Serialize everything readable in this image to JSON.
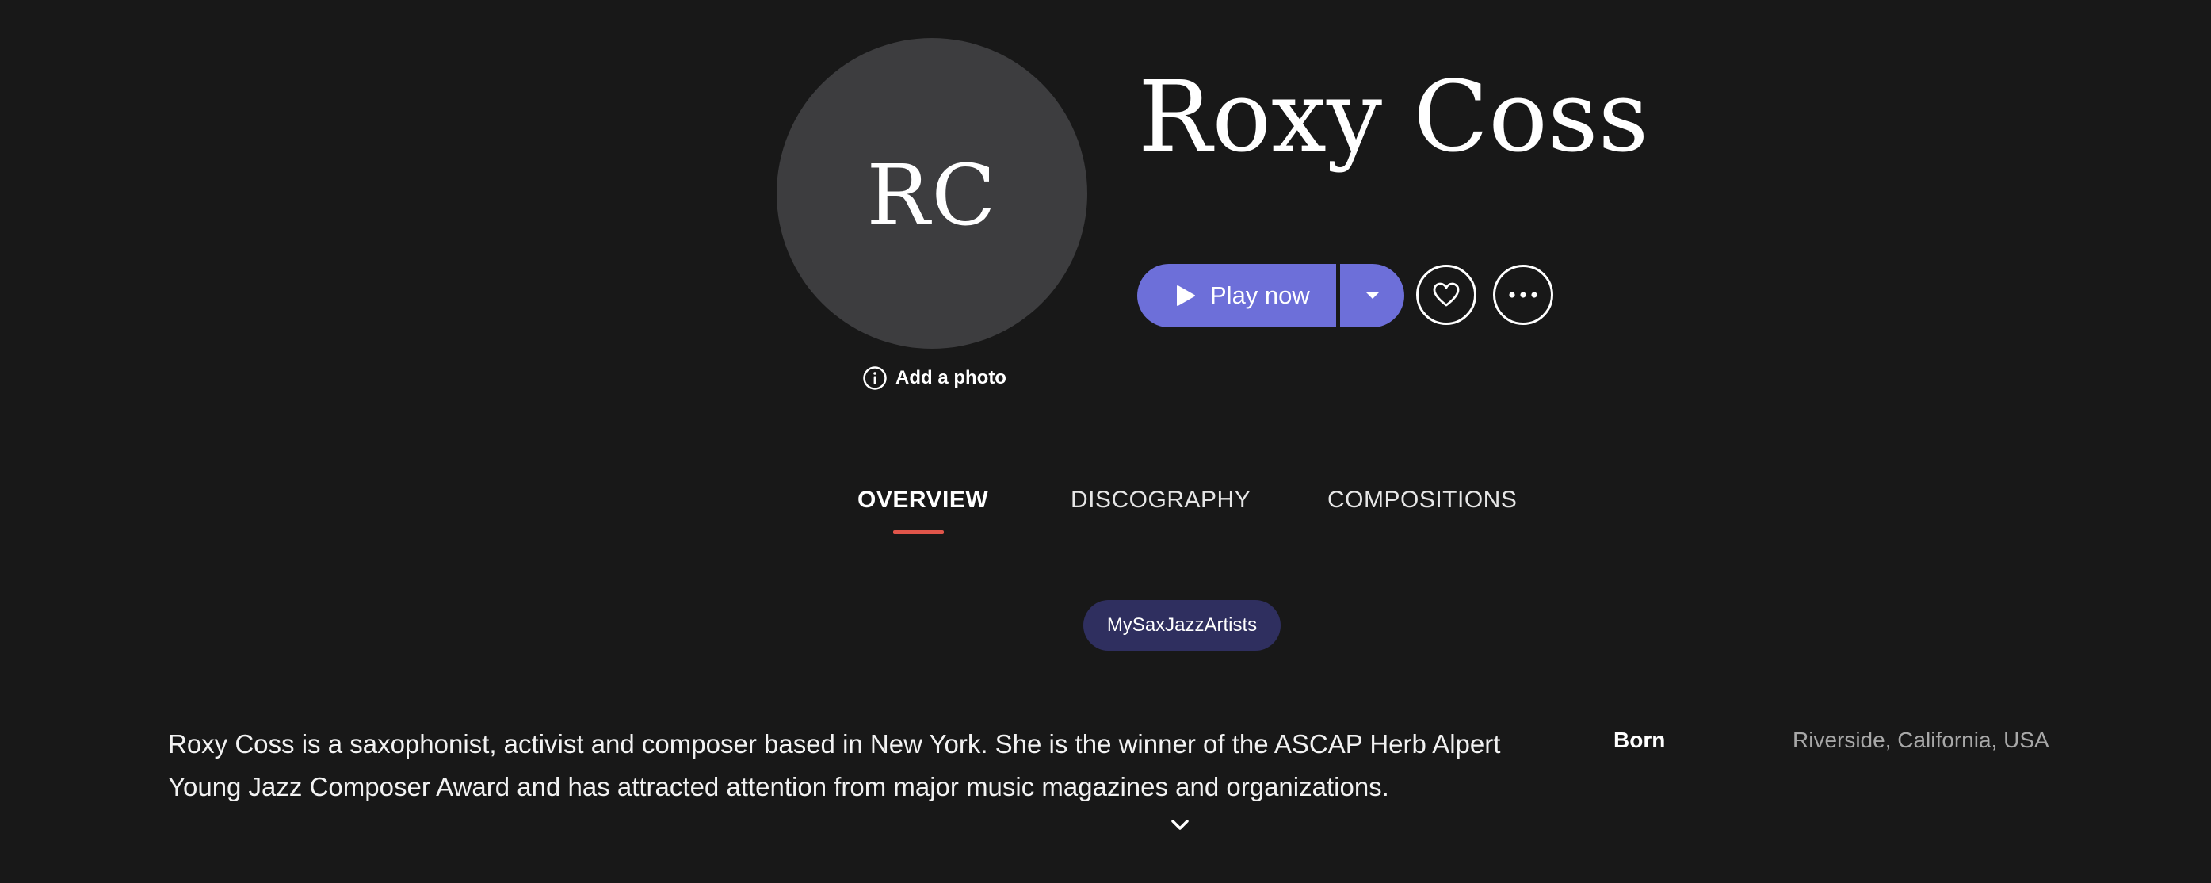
{
  "artist": {
    "initials": "RC",
    "name": "Roxy Coss",
    "add_photo_label": "Add a photo"
  },
  "actions": {
    "play_label": "Play now"
  },
  "tabs": [
    {
      "label": "OVERVIEW",
      "active": true
    },
    {
      "label": "DISCOGRAPHY",
      "active": false
    },
    {
      "label": "COMPOSITIONS",
      "active": false
    }
  ],
  "tag": "MySaxJazzArtists",
  "bio": "Roxy Coss is a saxophonist, activist and composer based in New York. She is the winner of the ASCAP Herb Alpert Young Jazz Composer Award and has attracted attention from major music magazines and organizations.",
  "facts": [
    {
      "label": "Born",
      "value": "Riverside, California, USA"
    }
  ],
  "colors": {
    "background": "#181818",
    "avatar": "#3d3d3f",
    "accent": "#6d6fd9",
    "tab_indicator": "#e0554a",
    "tag_background": "#2f2f5f"
  },
  "icons": [
    "info-icon",
    "play-icon",
    "caret-down-icon",
    "heart-icon",
    "ellipsis-icon",
    "chevron-down-icon"
  ]
}
